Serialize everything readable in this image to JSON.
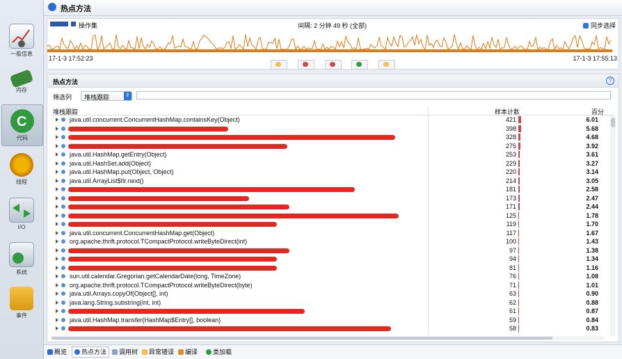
{
  "sidebar": {
    "items": [
      {
        "label": "一般信息",
        "icon": "gauge-icon"
      },
      {
        "label": "内存",
        "icon": "memory-icon"
      },
      {
        "label": "代码",
        "icon": "code-icon",
        "active": true
      },
      {
        "label": "线程",
        "icon": "gears-icon"
      },
      {
        "label": "I/O",
        "icon": "io-icon"
      },
      {
        "label": "系统",
        "icon": "server-icon"
      },
      {
        "label": "事件",
        "icon": "folder-icon"
      }
    ]
  },
  "header": {
    "title": "热点方法"
  },
  "timeline": {
    "legend": "操作集",
    "interval": "间隔: 2 分钟 49 秒 (全部)",
    "sync_label": "同步选择",
    "start_time": "17-1-3 17:52:23",
    "end_time": "17-1-3 17:55:13"
  },
  "panel": {
    "title": "热点方法",
    "help": "?",
    "filter_label": "筛选列",
    "filter_value": "堆栈跟踪",
    "filter_placeholder": ""
  },
  "table": {
    "columns": [
      "堆栈跟踪",
      "样本计数",
      "百分"
    ],
    "rows": [
      {
        "name": "java.util.concurrent.ConcurrentHashMap.containsKey(Object)",
        "count": "421",
        "pct": "6.01"
      },
      {
        "name": "",
        "count": "398",
        "pct": "5.68"
      },
      {
        "name": "",
        "count": "328",
        "pct": "4.68"
      },
      {
        "name": "",
        "count": "275",
        "pct": "3.92"
      },
      {
        "name": "java.util.HashMap.getEntry(Object)",
        "count": "253",
        "pct": "3.61"
      },
      {
        "name": "java.util.HashSet.add(Object)",
        "count": "229",
        "pct": "3.27"
      },
      {
        "name": "java.util.HashMap.put(Object, Object)",
        "count": "220",
        "pct": "3.14"
      },
      {
        "name": "java.util.ArrayList$Itr.next()",
        "count": "214",
        "pct": "3.05"
      },
      {
        "name": "",
        "count": "181",
        "pct": "2.58"
      },
      {
        "name": "",
        "count": "173",
        "pct": "2.47"
      },
      {
        "name": "",
        "count": "171",
        "pct": "2.44"
      },
      {
        "name": "",
        "count": "125",
        "pct": "1.78"
      },
      {
        "name": "",
        "count": "119",
        "pct": "1.70"
      },
      {
        "name": "java.util.concurrent.ConcurrentHashMap.get(Object)",
        "count": "117",
        "pct": "1.67"
      },
      {
        "name": "org.apache.thrift.protocol.TCompactProtocol.writeByteDirect(int)",
        "count": "100",
        "pct": "1.43"
      },
      {
        "name": "",
        "count": "97",
        "pct": "1.38"
      },
      {
        "name": "",
        "count": "94",
        "pct": "1.34"
      },
      {
        "name": "",
        "count": "81",
        "pct": "1.16"
      },
      {
        "name": "sun.util.calendar.Gregorian.getCalendarDate(long, TimeZone)",
        "count": "76",
        "pct": "1.08"
      },
      {
        "name": "org.apache.thrift.protocol.TCompactProtocol.writeByteDirect(byte)",
        "count": "71",
        "pct": "1.01"
      },
      {
        "name": "java.util.Arrays.copyOf(Object[], int)",
        "count": "63",
        "pct": "0.90"
      },
      {
        "name": "java.lang.String.substring(int, int)",
        "count": "62",
        "pct": "0.88"
      },
      {
        "name": "",
        "count": "61",
        "pct": "0.87"
      },
      {
        "name": "java.util.HashMap.transfer(HashMap$Entry[], boolean)",
        "count": "59",
        "pct": "0.84"
      },
      {
        "name": "",
        "count": "58",
        "pct": "0.83"
      }
    ]
  },
  "bottom_tabs": [
    {
      "label": "概览",
      "icon": "overview-icon"
    },
    {
      "label": "热点方法",
      "icon": "hotspot-icon",
      "active": true
    },
    {
      "label": "调用树",
      "icon": "calltree-icon"
    },
    {
      "label": "异常错误",
      "icon": "exception-icon"
    },
    {
      "label": "编译",
      "icon": "compile-icon"
    },
    {
      "label": "类加载",
      "icon": "classload-icon"
    }
  ],
  "colors": {
    "accent": "#2a78d8",
    "bar": "#c94848",
    "redact": "#e5271f",
    "spark": "#e07b16"
  }
}
